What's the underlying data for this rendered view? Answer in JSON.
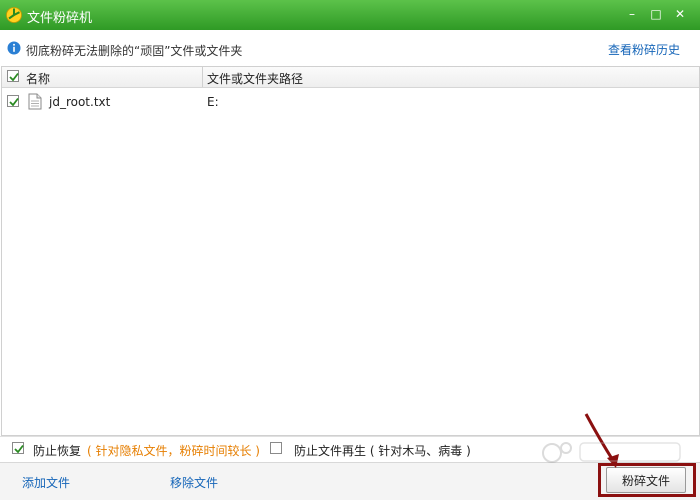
{
  "window": {
    "title": "文件粉碎机",
    "controls": {
      "minimize": "–",
      "maximize": "□",
      "close": "✕"
    }
  },
  "infobar": {
    "message": "彻底粉碎无法删除的“顽固”文件或文件夹",
    "history_link": "查看粉碎历史"
  },
  "table": {
    "columns": [
      "名称",
      "文件或文件夹路径"
    ],
    "header_checked": true,
    "rows": [
      {
        "name": "jd_root.txt",
        "path": "E:",
        "checked": true
      }
    ]
  },
  "options": {
    "prevent_recovery": {
      "label": "防止恢复",
      "hint": "( 针对隐私文件，粉碎时间较长 )",
      "checked": true
    },
    "prevent_regeneration": {
      "label": "防止文件再生 ( 针对木马、病毒 )",
      "checked": false
    }
  },
  "bottombar": {
    "add_file": "添加文件",
    "remove_file": "移除文件",
    "shred_button": "粉碎文件"
  },
  "colors": {
    "titlebar": "#3aa82e",
    "link": "#1565b8",
    "hint": "#e67e00",
    "highlight": "#8b1010"
  },
  "icons": {
    "app": "360-logo-icon",
    "info": "info-icon",
    "file": "text-file-icon"
  }
}
